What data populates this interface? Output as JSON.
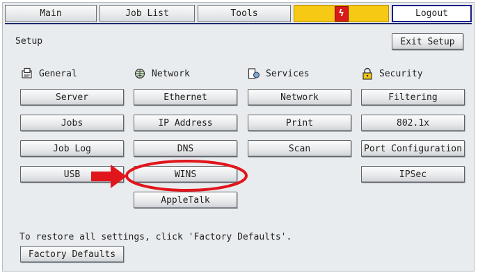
{
  "tabs": {
    "main": "Main",
    "job_list": "Job List",
    "tools": "Tools",
    "alert_icon": "alert-icon",
    "logout": "Logout"
  },
  "setup": {
    "title": "Setup",
    "exit_label": "Exit Setup"
  },
  "categories": {
    "general": "General",
    "network": "Network",
    "services": "Services",
    "security": "Security"
  },
  "general_buttons": [
    "Server",
    "Jobs",
    "Job Log",
    "USB"
  ],
  "network_buttons": [
    "Ethernet",
    "IP Address",
    "DNS",
    "WINS",
    "AppleTalk"
  ],
  "services_buttons": [
    "Network",
    "Print",
    "Scan"
  ],
  "security_buttons": [
    "Filtering",
    "802.1x",
    "Port Configuration",
    "IPSec"
  ],
  "footer": {
    "restore_text": "To restore all settings, click 'Factory Defaults'.",
    "factory_defaults": "Factory Defaults"
  },
  "annotation": {
    "highlight_color": "#e0161c",
    "highlighted_item": "WINS"
  }
}
